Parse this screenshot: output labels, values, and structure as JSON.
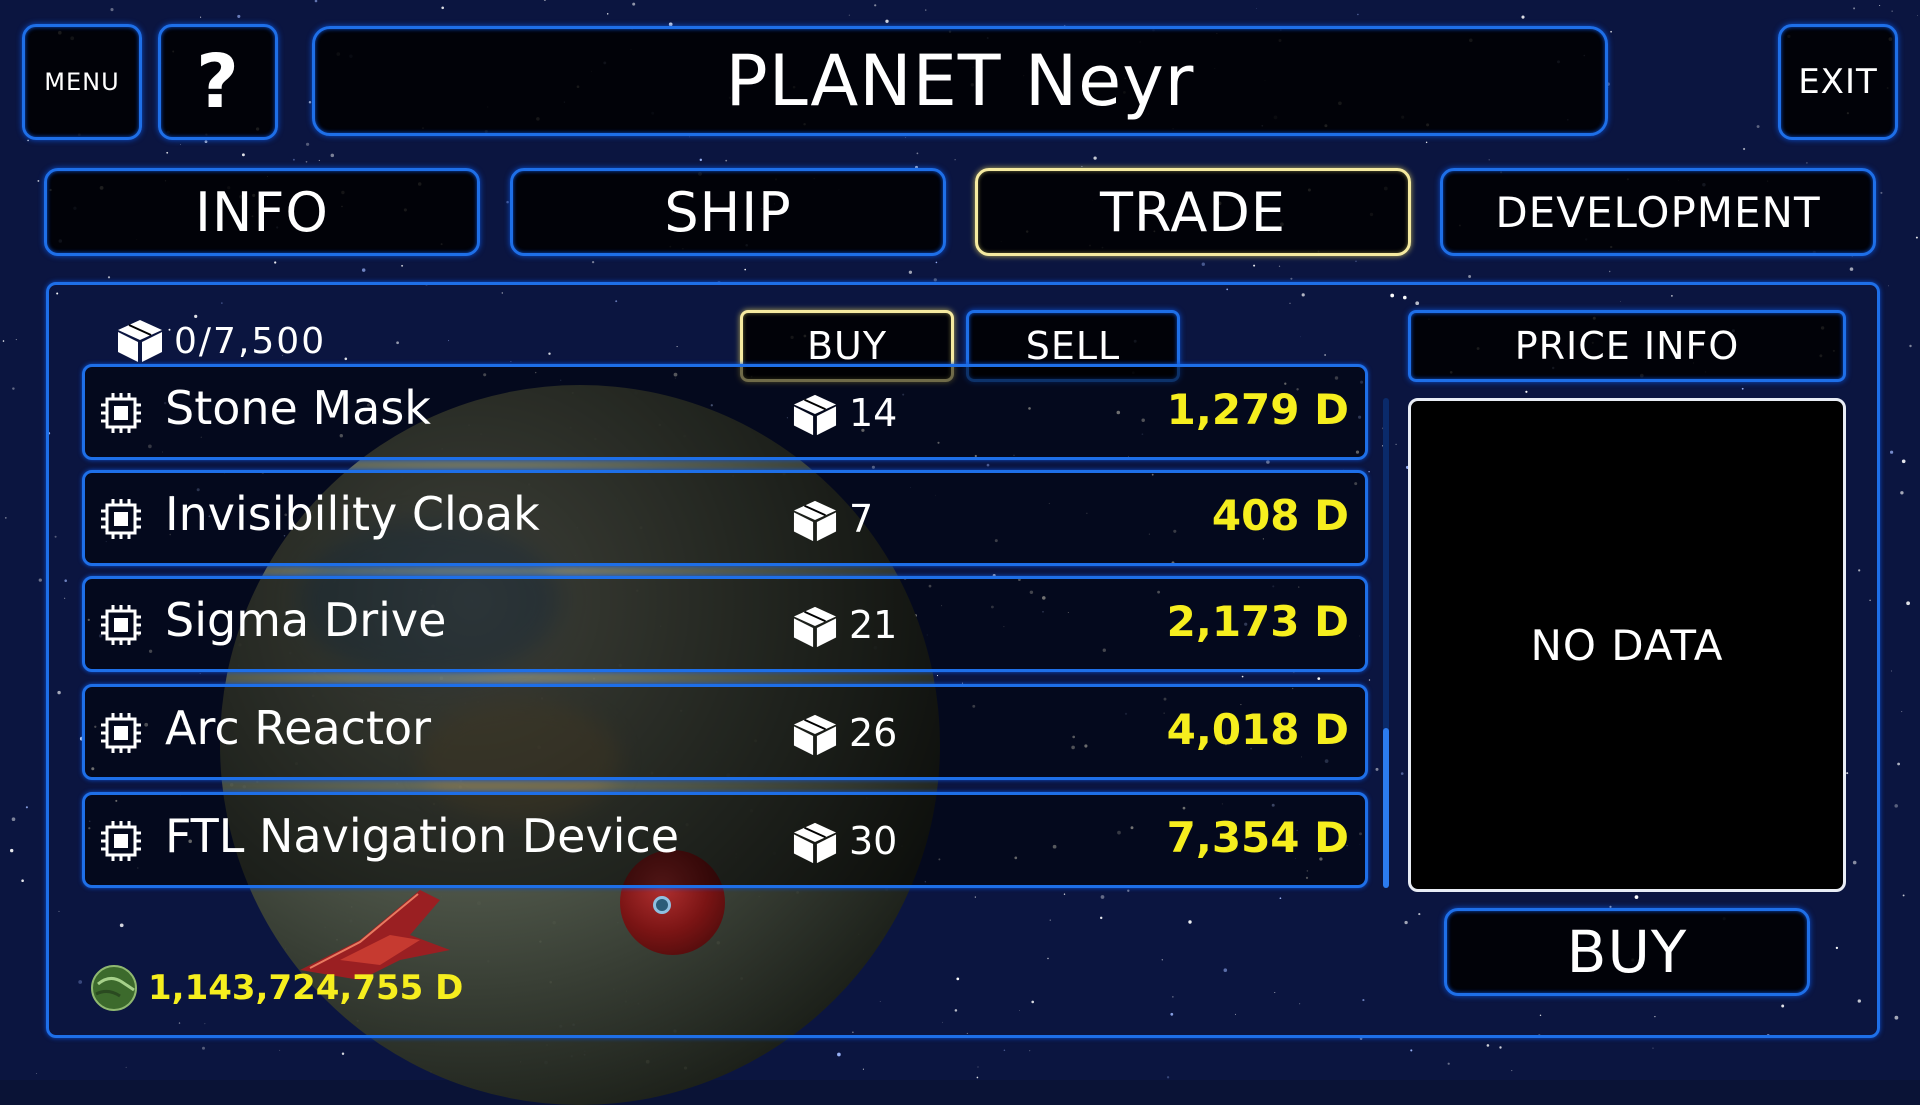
{
  "header": {
    "menu_label": "MENU",
    "help_label": "?",
    "title": "PLANET Neyr",
    "exit_label": "EXIT"
  },
  "tabs": [
    {
      "label": "INFO",
      "active": false
    },
    {
      "label": "SHIP",
      "active": false
    },
    {
      "label": "TRADE",
      "active": true
    },
    {
      "label": "DEVELOPMENT",
      "active": false
    }
  ],
  "trade": {
    "cargo": "0/7,500",
    "mode_buy_label": "BUY",
    "mode_sell_label": "SELL",
    "active_mode": "BUY",
    "items": [
      {
        "name": "Stone Mask",
        "qty": "14",
        "price": "1,279 D"
      },
      {
        "name": "Invisibility Cloak",
        "qty": "7",
        "price": "408 D"
      },
      {
        "name": "Sigma Drive",
        "qty": "21",
        "price": "2,173 D"
      },
      {
        "name": "Arc Reactor",
        "qty": "26",
        "price": "4,018 D"
      },
      {
        "name": "FTL Navigation Device",
        "qty": "30",
        "price": "7,354 D"
      }
    ],
    "credits": "1,143,724,755 D"
  },
  "price_info": {
    "header": "PRICE INFO",
    "content": "NO DATA",
    "buy_label": "BUY"
  },
  "colors": {
    "accent_blue": "#1e6fe8",
    "active_tab_border": "#f5eaa0",
    "price_yellow": "#f6ee1e",
    "background": "#0a1336"
  }
}
